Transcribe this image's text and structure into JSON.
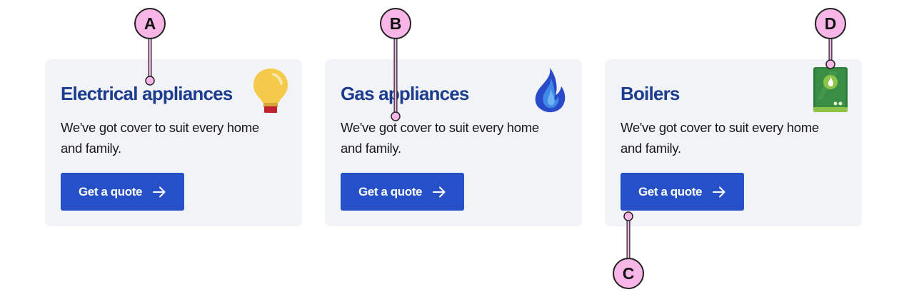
{
  "cards": [
    {
      "title": "Electrical appliances",
      "description": "We've got cover to suit every home and family.",
      "button_label": "Get a quote",
      "icon": "lightbulb-icon"
    },
    {
      "title": "Gas appliances",
      "description": "We've got cover to suit every home and family.",
      "button_label": "Get a quote",
      "icon": "flame-icon"
    },
    {
      "title": "Boilers",
      "description": "We've got cover to suit every home and family.",
      "button_label": "Get a quote",
      "icon": "boiler-icon"
    }
  ],
  "markers": {
    "a": "A",
    "b": "B",
    "c": "C",
    "d": "D"
  },
  "colors": {
    "card_background": "#f2f3f6",
    "title_color": "#1b3c8f",
    "button_color": "#2650c7",
    "marker_fill": "#f7b6e6"
  }
}
